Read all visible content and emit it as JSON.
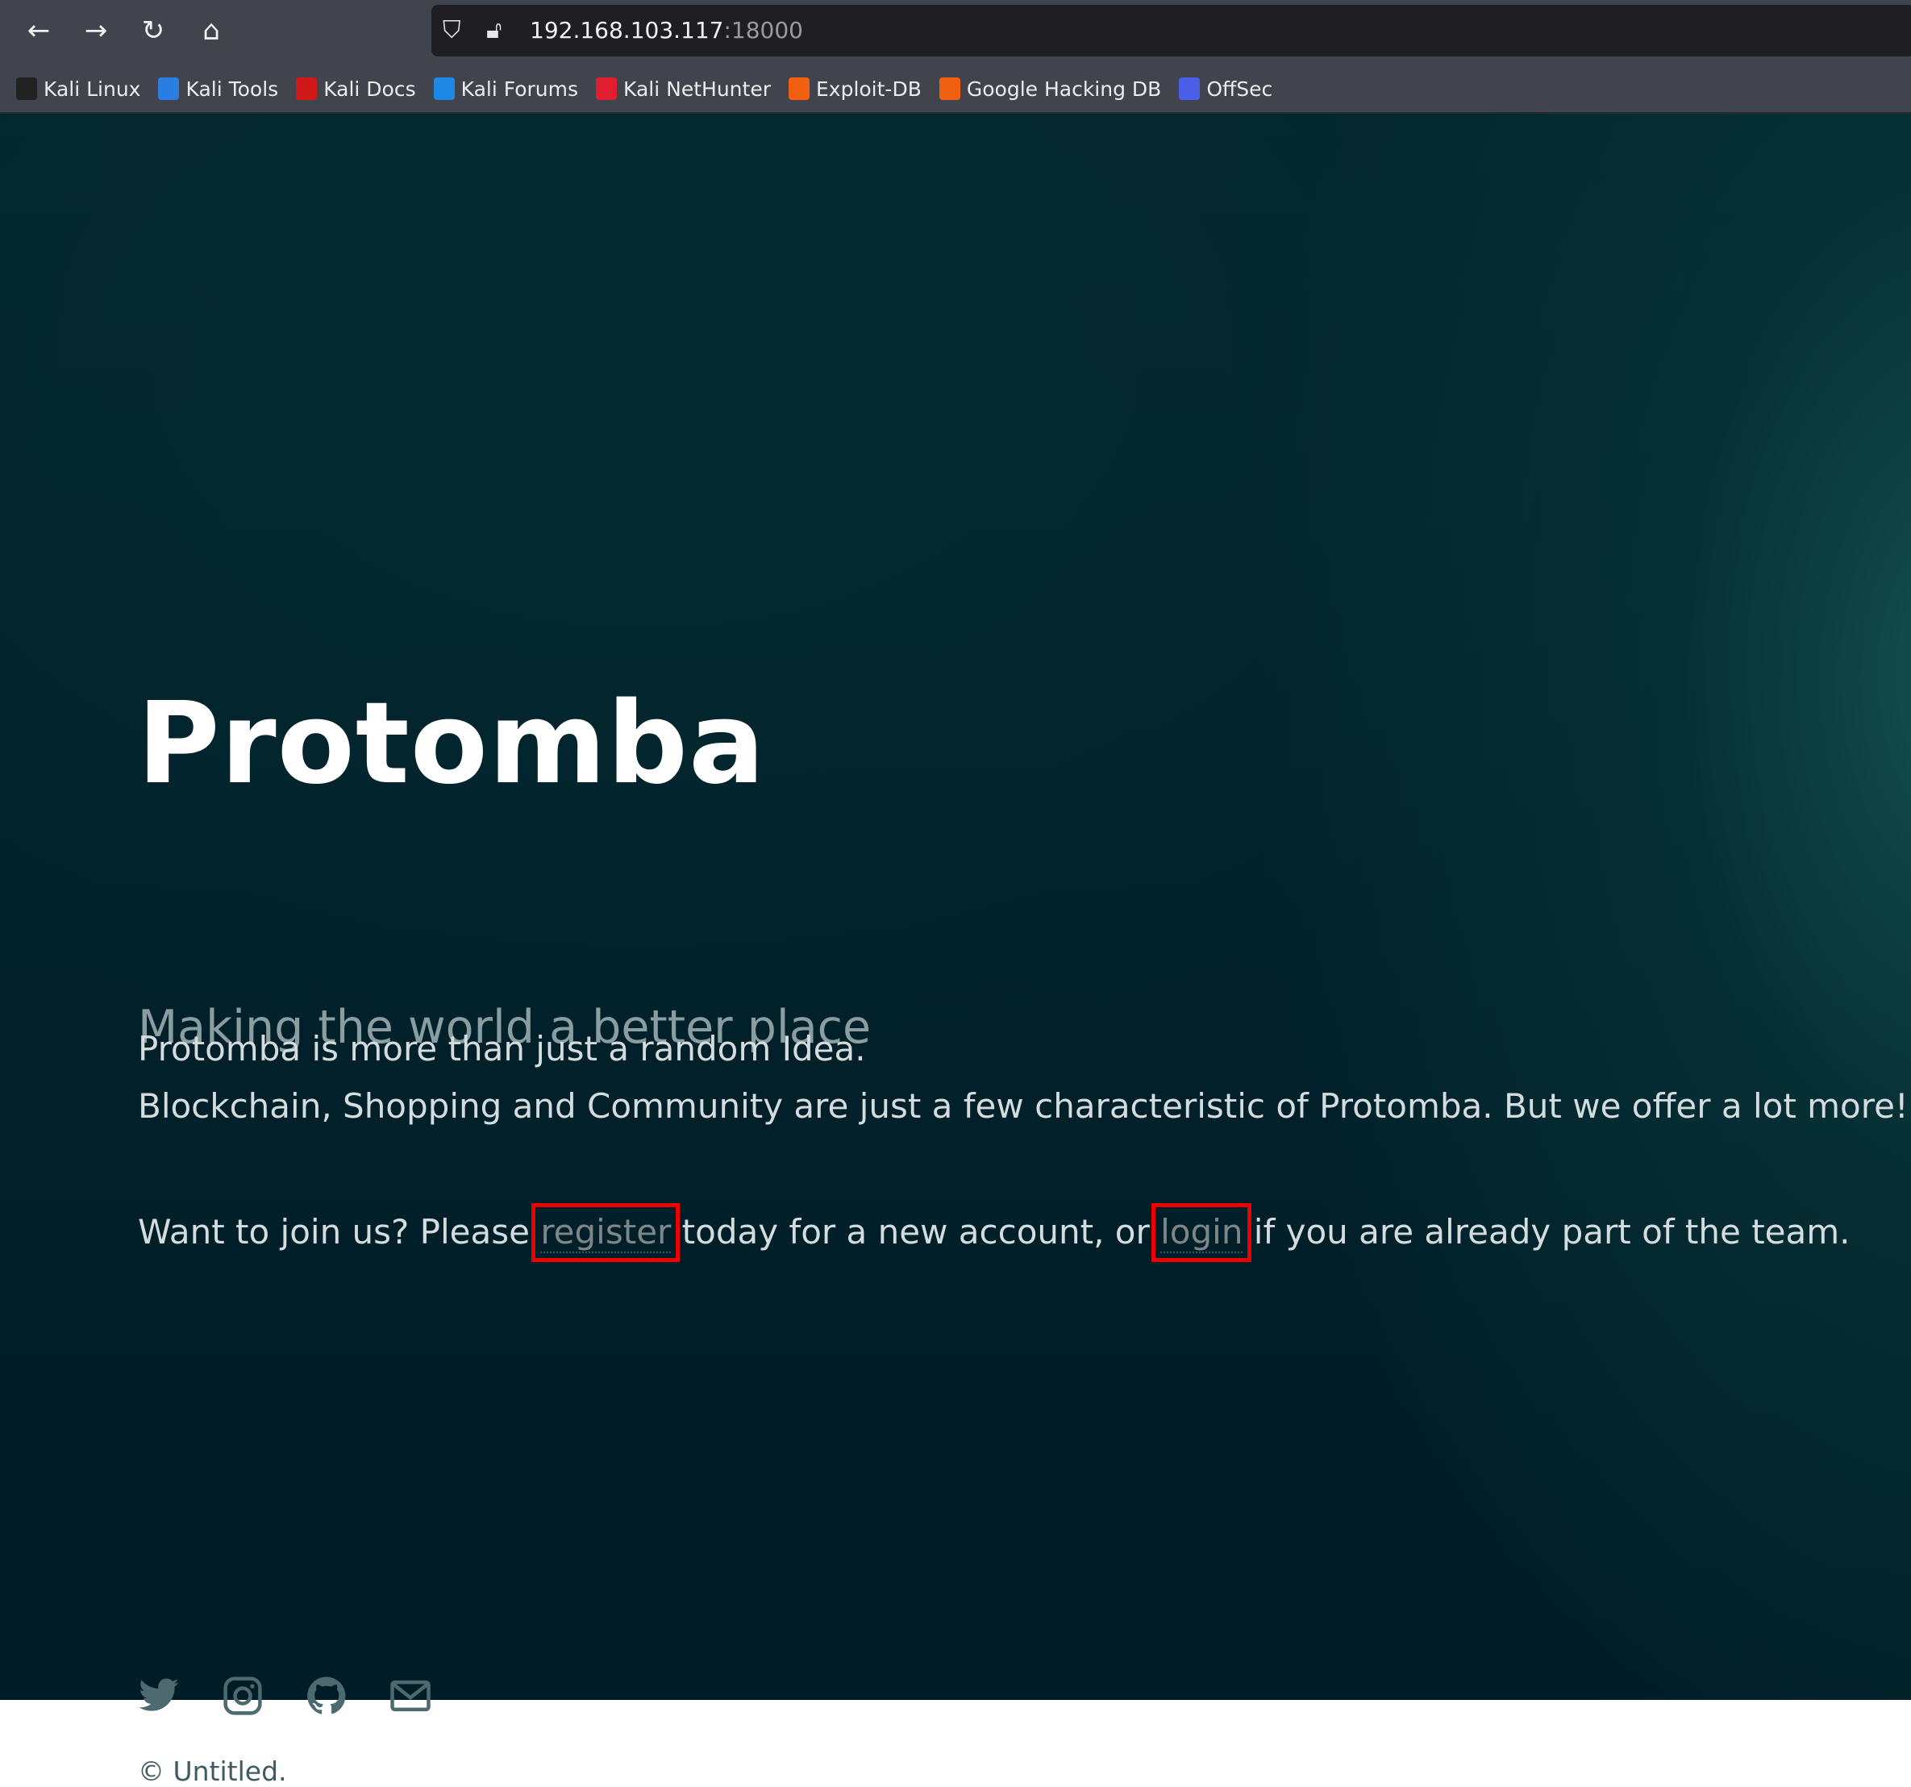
{
  "browser": {
    "url_host": "192.168.103.117",
    "url_port": ":18000",
    "bookmarks": [
      {
        "label": "Kali Linux",
        "color": "#222222"
      },
      {
        "label": "Kali Tools",
        "color": "#2a7de1"
      },
      {
        "label": "Kali Docs",
        "color": "#d01818"
      },
      {
        "label": "Kali Forums",
        "color": "#1e88e5"
      },
      {
        "label": "Kali NetHunter",
        "color": "#e02030"
      },
      {
        "label": "Exploit-DB",
        "color": "#f06010"
      },
      {
        "label": "Google Hacking DB",
        "color": "#f06010"
      },
      {
        "label": "OffSec",
        "color": "#4a5ee8"
      }
    ]
  },
  "hero": {
    "title": "Protomba",
    "subtitle": "Making the world a better place",
    "line1": "Protomba is more than just a random Idea.",
    "line2": "Blockchain, Shopping and Community are just a few characteristic of Protomba. But we offer a lot more!",
    "join_prefix": "Want to join us? Please ",
    "register_link": "register",
    "join_middle": " today for a new account, or ",
    "login_link": "login",
    "join_suffix": " if you are already part of the team."
  },
  "footer": {
    "socials": [
      "twitter-icon",
      "instagram-icon",
      "github-icon",
      "mail-icon"
    ],
    "copyright": "© Untitled."
  }
}
